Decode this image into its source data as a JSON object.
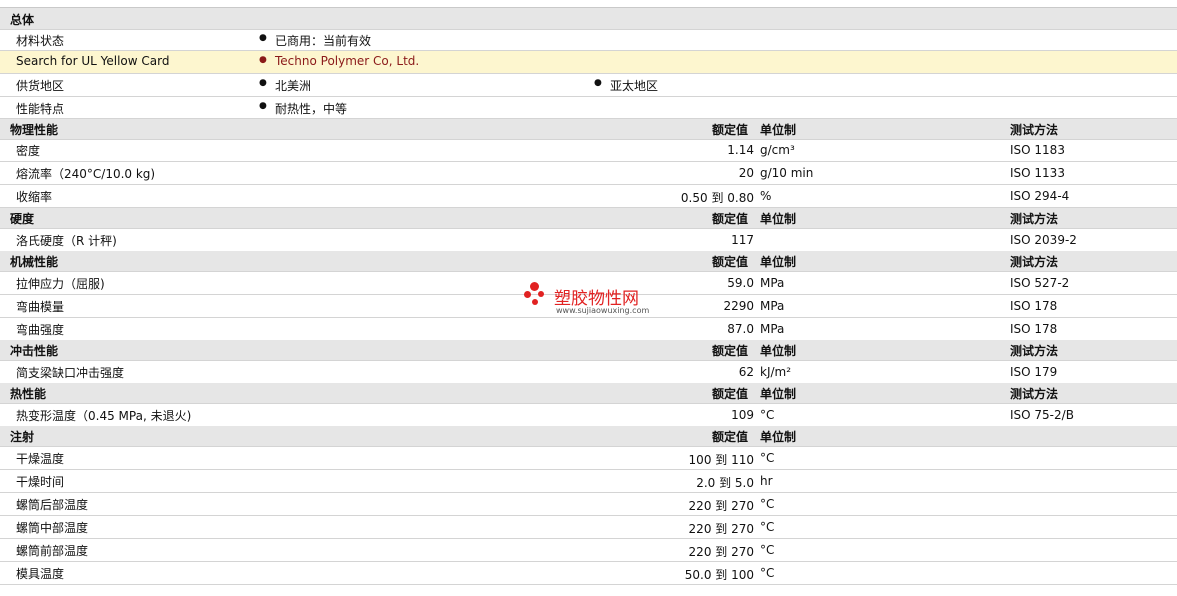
{
  "overview": {
    "section": "总体",
    "rows": [
      {
        "label": "材料状态",
        "value": "已商用：当前有效"
      },
      {
        "label": "Search for UL Yellow Card",
        "value": "Techno Polymer Co, Ltd."
      },
      {
        "label": "供货地区",
        "value": "北美洲",
        "value2": "亚太地区"
      },
      {
        "label": "性能特点",
        "value": "耐热性，中等"
      }
    ]
  },
  "col_headers": {
    "nominal": "额定值",
    "unit": "单位制",
    "method": "测试方法"
  },
  "sections": [
    {
      "title": "物理性能",
      "rows": [
        {
          "label": "密度",
          "value": "1.14",
          "unit": "g/cm³",
          "method": "ISO 1183"
        },
        {
          "label": "熔流率（240°C/10.0 kg)",
          "value": "20",
          "unit": "g/10 min",
          "method": "ISO 1133"
        },
        {
          "label": "收缩率",
          "value": "0.50 到  0.80",
          "unit": "%",
          "method": "ISO 294-4"
        }
      ]
    },
    {
      "title": "硬度",
      "rows": [
        {
          "label": "洛氏硬度（R 计秤)",
          "value": "117",
          "unit": "",
          "method": "ISO 2039-2"
        }
      ]
    },
    {
      "title": "机械性能",
      "rows": [
        {
          "label": "拉伸应力（屈服)",
          "value": "59.0",
          "unit": "MPa",
          "method": "ISO 527-2"
        },
        {
          "label": "弯曲模量",
          "value": "2290",
          "unit": "MPa",
          "method": "ISO 178"
        },
        {
          "label": "弯曲强度",
          "value": "87.0",
          "unit": "MPa",
          "method": "ISO 178"
        }
      ]
    },
    {
      "title": "冲击性能",
      "rows": [
        {
          "label": "简支梁缺口冲击强度",
          "value": "62",
          "unit": "kJ/m²",
          "method": "ISO 179"
        }
      ]
    },
    {
      "title": "热性能",
      "rows": [
        {
          "label": "热变形温度（0.45 MPa, 未退火)",
          "value": "109",
          "unit": "°C",
          "method": "ISO 75-2/B"
        }
      ]
    },
    {
      "title": "注射",
      "rows": [
        {
          "label": "干燥温度",
          "value": "100 到  110",
          "unit": "°C",
          "method": ""
        },
        {
          "label": "干燥时间",
          "value": "2.0 到  5.0",
          "unit": "hr",
          "method": ""
        },
        {
          "label": "螺筒后部温度",
          "value": "220 到  270",
          "unit": "°C",
          "method": ""
        },
        {
          "label": "螺筒中部温度",
          "value": "220 到  270",
          "unit": "°C",
          "method": ""
        },
        {
          "label": "螺筒前部温度",
          "value": "220 到  270",
          "unit": "°C",
          "method": ""
        },
        {
          "label": "模具温度",
          "value": "50.0 到  100",
          "unit": "°C",
          "method": ""
        }
      ]
    }
  ],
  "watermark": {
    "text": "塑胶物性网",
    "url": "www.sujiaowuxing.com"
  }
}
